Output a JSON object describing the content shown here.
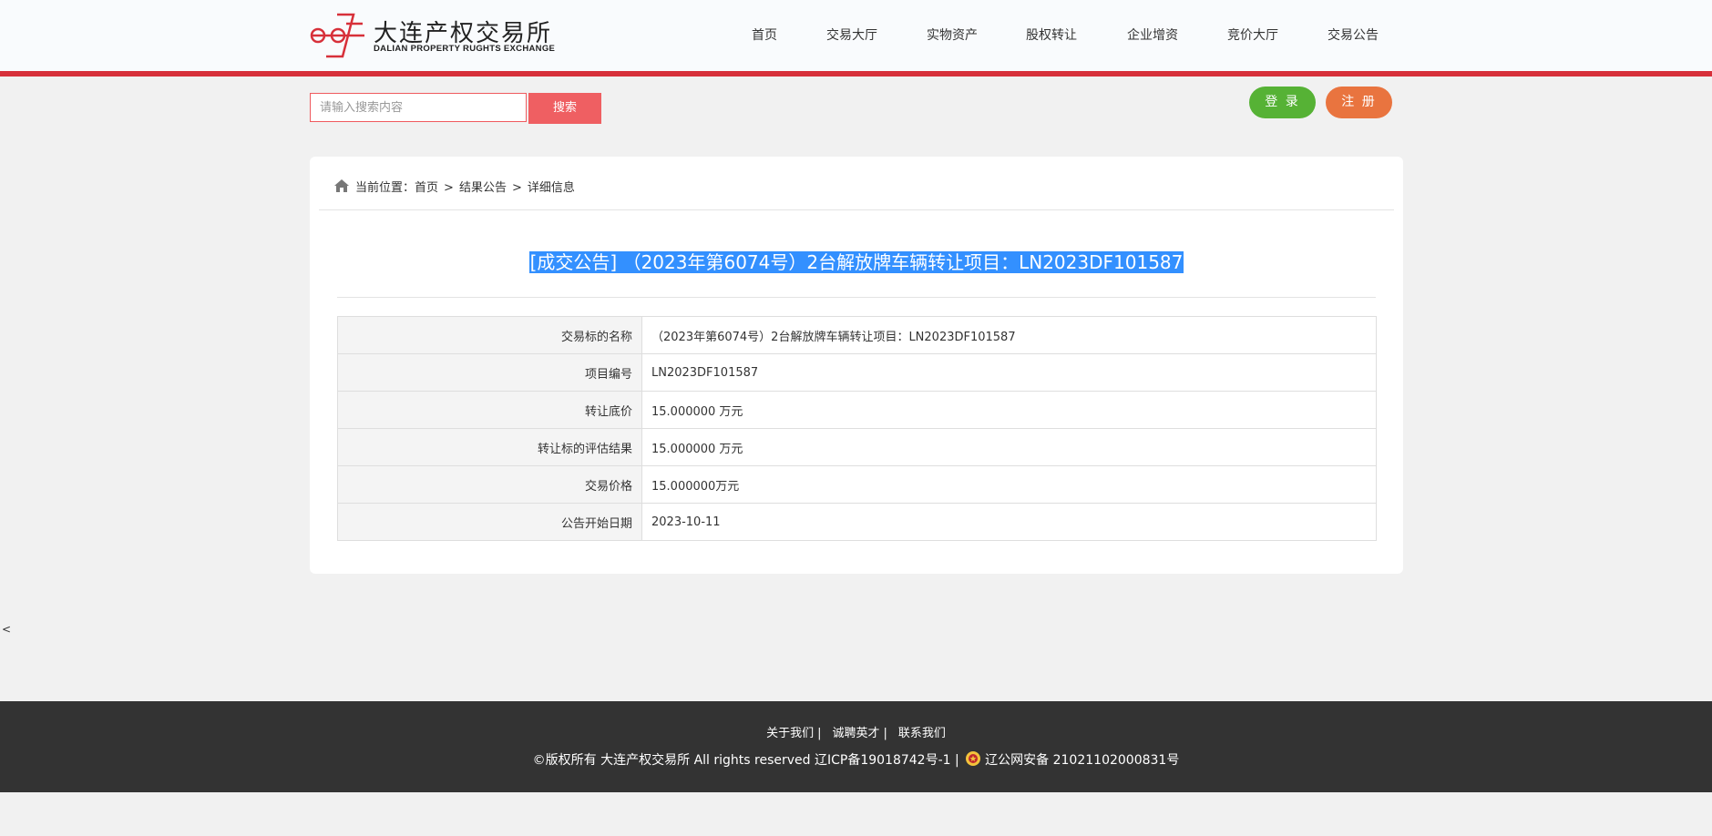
{
  "header": {
    "logo_cn": "大连产权交易所",
    "logo_en": "DALIAN PROPERTY RUGHTS EXCHANGE",
    "nav": [
      "首页",
      "交易大厅",
      "实物资产",
      "股权转让",
      "企业增资",
      "竞价大厅",
      "交易公告"
    ]
  },
  "search": {
    "placeholder": "请输入搜索内容",
    "button": "搜索"
  },
  "auth": {
    "login": "登 录",
    "register": "注 册"
  },
  "breadcrumb": {
    "prefix": "当前位置：",
    "items": [
      "首页",
      "结果公告",
      "详细信息"
    ],
    "separator": ">"
  },
  "detail": {
    "title": "[成交公告] （2023年第6074号）2台解放牌车辆转让项目：LN2023DF101587",
    "rows": [
      {
        "label": "交易标的名称",
        "value": "（2023年第6074号）2台解放牌车辆转让项目：LN2023DF101587"
      },
      {
        "label": "项目编号",
        "value": "LN2023DF101587"
      },
      {
        "label": "转让底价",
        "value": "15.000000 万元"
      },
      {
        "label": "转让标的评估结果",
        "value": "15.000000 万元"
      },
      {
        "label": "交易价格",
        "value": "15.000000万元"
      },
      {
        "label": "公告开始日期",
        "value": "2023-10-11"
      }
    ]
  },
  "stray_text": "<",
  "footer": {
    "links": [
      "关于我们",
      "诚聘英才",
      "联系我们"
    ],
    "link_separator": "|",
    "copyright": "©版权所有 大连产权交易所 All rights reserved 辽ICP备19018742号-1 |",
    "police_record": "辽公网安备 21021102000831号"
  },
  "colors": {
    "accent_red": "#d7303a",
    "search_red": "#ef5f62",
    "login_green": "#56b235",
    "register_orange": "#e9743f",
    "selection_blue": "#3390ff",
    "footer_bg": "#333333"
  },
  "icons": {
    "breadcrumb": "home-icon",
    "footer": "police-badge-icon"
  }
}
